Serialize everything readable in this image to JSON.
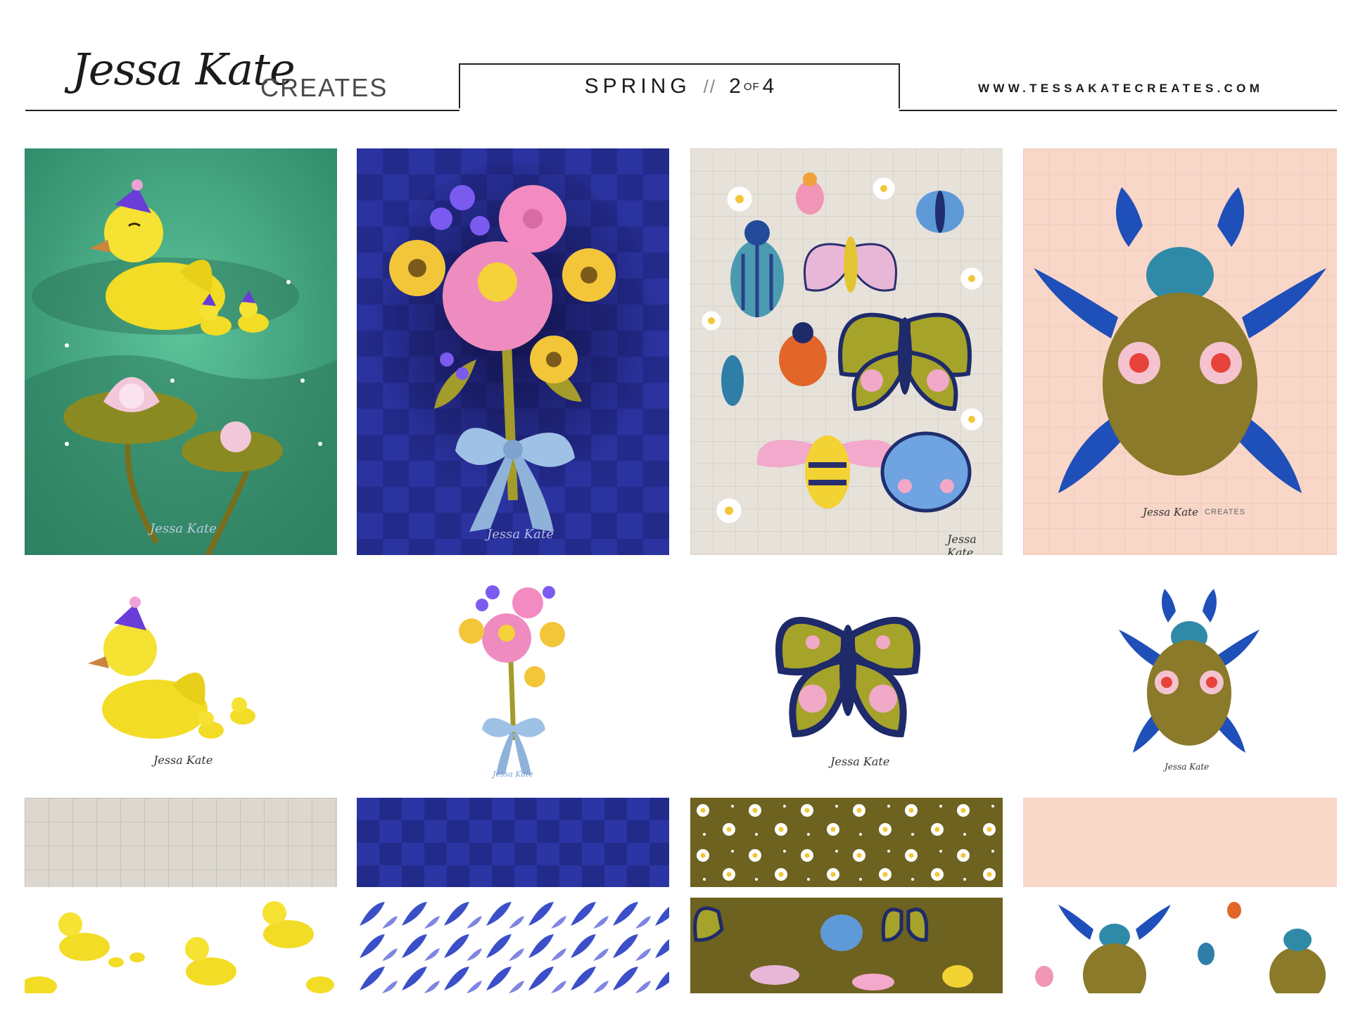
{
  "header": {
    "brand_script": "Jessa Kate",
    "brand_word": "CREATES",
    "season": "SPRING",
    "separator": "//",
    "page_current": "2",
    "page_of": "OF",
    "page_total": "4",
    "url": "WWW.TESSAKATECREATES.COM"
  },
  "signatures": {
    "ducks_print": "Jessa Kate",
    "bouquet_print": "Jessa Kate",
    "insects_print": "Jessa Kate",
    "beetle_print": "Jessa Kate",
    "beetle_print_word": "CREATES",
    "ducks_motif": "Jessa Kate",
    "bouquet_motif": "Jessa Kate",
    "butterfly_motif": "Jessa Kate",
    "beetle_motif": "Jessa Kate"
  },
  "colors": {
    "pond_green": "#3f9a78",
    "navy": "#232a8a",
    "parchment": "#e6e2da",
    "blush": "#f8d6c8",
    "olive": "#6d6220",
    "duck_yellow": "#f3df2a",
    "cobalt": "#1f4fb8"
  }
}
